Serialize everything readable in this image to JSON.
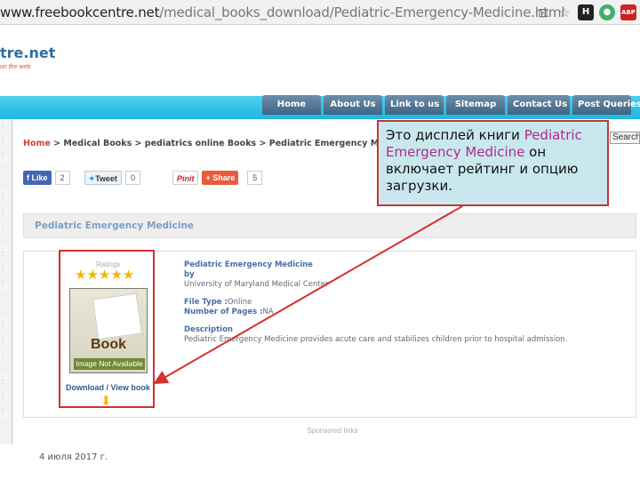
{
  "browser": {
    "url_host": "www.freebookcentre.net",
    "url_path": "/medical_books_download/Pediatric-Emergency-Medicine.html",
    "ext_h": "H",
    "ext_abp": "ABP"
  },
  "site": {
    "logo_text": "tre.net",
    "tagline": "on the web"
  },
  "nav": [
    "Home",
    "About Us",
    "Link to us",
    "Sitemap",
    "Contact Us",
    "Post Queries"
  ],
  "breadcrumb": {
    "home": "Home",
    "rest": " > Medical Books > pediatrics online Books > Pediatric Emergency Medicine"
  },
  "search_label": "Search",
  "social": {
    "like": "Like",
    "like_count": "2",
    "tweet": "Tweet",
    "tweet_count": "0",
    "pin": "Pinit",
    "share": "Share",
    "share_count": "5"
  },
  "book": {
    "panel_title": "Pediatric Emergency Medicine",
    "ratings_label": "Ratings",
    "stars": 5,
    "cover_word": "Book",
    "cover_na": "Image Not Available",
    "download": "Download / View book",
    "title": "Pediatric Emergency Medicine",
    "by": "by",
    "author": "University of Maryland Medical Center",
    "file_type_label": "File Type :",
    "file_type": "Online",
    "pages_label": "Number of Pages :",
    "pages": "NA",
    "description_label": "Description",
    "description": "Pediatric Emergency Medicine provides acute care and stabilizes children prior to hospital admission."
  },
  "sponsored": "Sponsored links",
  "date": "4 июля 2017 г.",
  "callout": {
    "before": "Это дисплей книги ",
    "highlight": "Pediatric Emergency Medicine",
    "after": " он включает рейтинг и опцию загрузки."
  },
  "colors": {
    "accent_cyan": "#1fb6e0",
    "nav_bg": "#3e6486",
    "annotation_red": "#d43030",
    "callout_bg": "#c9e8ee"
  }
}
